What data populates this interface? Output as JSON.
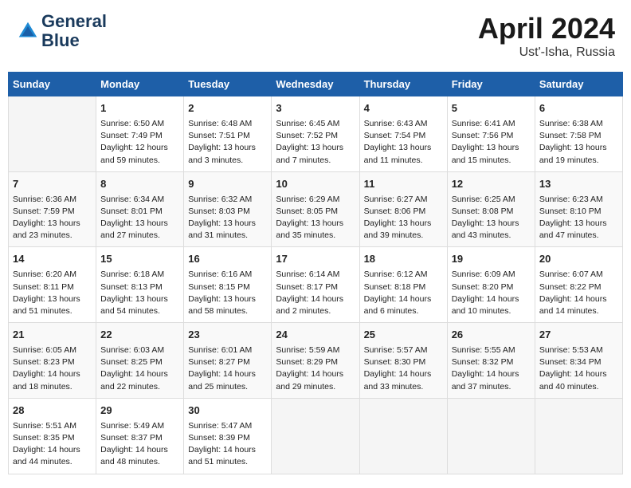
{
  "header": {
    "logo_line1": "General",
    "logo_line2": "Blue",
    "title": "April 2024",
    "subtitle": "Ust'-Isha, Russia"
  },
  "days_of_week": [
    "Sunday",
    "Monday",
    "Tuesday",
    "Wednesday",
    "Thursday",
    "Friday",
    "Saturday"
  ],
  "weeks": [
    [
      {
        "day": "",
        "content": ""
      },
      {
        "day": "1",
        "content": "Sunrise: 6:50 AM\nSunset: 7:49 PM\nDaylight: 12 hours\nand 59 minutes."
      },
      {
        "day": "2",
        "content": "Sunrise: 6:48 AM\nSunset: 7:51 PM\nDaylight: 13 hours\nand 3 minutes."
      },
      {
        "day": "3",
        "content": "Sunrise: 6:45 AM\nSunset: 7:52 PM\nDaylight: 13 hours\nand 7 minutes."
      },
      {
        "day": "4",
        "content": "Sunrise: 6:43 AM\nSunset: 7:54 PM\nDaylight: 13 hours\nand 11 minutes."
      },
      {
        "day": "5",
        "content": "Sunrise: 6:41 AM\nSunset: 7:56 PM\nDaylight: 13 hours\nand 15 minutes."
      },
      {
        "day": "6",
        "content": "Sunrise: 6:38 AM\nSunset: 7:58 PM\nDaylight: 13 hours\nand 19 minutes."
      }
    ],
    [
      {
        "day": "7",
        "content": "Sunrise: 6:36 AM\nSunset: 7:59 PM\nDaylight: 13 hours\nand 23 minutes."
      },
      {
        "day": "8",
        "content": "Sunrise: 6:34 AM\nSunset: 8:01 PM\nDaylight: 13 hours\nand 27 minutes."
      },
      {
        "day": "9",
        "content": "Sunrise: 6:32 AM\nSunset: 8:03 PM\nDaylight: 13 hours\nand 31 minutes."
      },
      {
        "day": "10",
        "content": "Sunrise: 6:29 AM\nSunset: 8:05 PM\nDaylight: 13 hours\nand 35 minutes."
      },
      {
        "day": "11",
        "content": "Sunrise: 6:27 AM\nSunset: 8:06 PM\nDaylight: 13 hours\nand 39 minutes."
      },
      {
        "day": "12",
        "content": "Sunrise: 6:25 AM\nSunset: 8:08 PM\nDaylight: 13 hours\nand 43 minutes."
      },
      {
        "day": "13",
        "content": "Sunrise: 6:23 AM\nSunset: 8:10 PM\nDaylight: 13 hours\nand 47 minutes."
      }
    ],
    [
      {
        "day": "14",
        "content": "Sunrise: 6:20 AM\nSunset: 8:11 PM\nDaylight: 13 hours\nand 51 minutes."
      },
      {
        "day": "15",
        "content": "Sunrise: 6:18 AM\nSunset: 8:13 PM\nDaylight: 13 hours\nand 54 minutes."
      },
      {
        "day": "16",
        "content": "Sunrise: 6:16 AM\nSunset: 8:15 PM\nDaylight: 13 hours\nand 58 minutes."
      },
      {
        "day": "17",
        "content": "Sunrise: 6:14 AM\nSunset: 8:17 PM\nDaylight: 14 hours\nand 2 minutes."
      },
      {
        "day": "18",
        "content": "Sunrise: 6:12 AM\nSunset: 8:18 PM\nDaylight: 14 hours\nand 6 minutes."
      },
      {
        "day": "19",
        "content": "Sunrise: 6:09 AM\nSunset: 8:20 PM\nDaylight: 14 hours\nand 10 minutes."
      },
      {
        "day": "20",
        "content": "Sunrise: 6:07 AM\nSunset: 8:22 PM\nDaylight: 14 hours\nand 14 minutes."
      }
    ],
    [
      {
        "day": "21",
        "content": "Sunrise: 6:05 AM\nSunset: 8:23 PM\nDaylight: 14 hours\nand 18 minutes."
      },
      {
        "day": "22",
        "content": "Sunrise: 6:03 AM\nSunset: 8:25 PM\nDaylight: 14 hours\nand 22 minutes."
      },
      {
        "day": "23",
        "content": "Sunrise: 6:01 AM\nSunset: 8:27 PM\nDaylight: 14 hours\nand 25 minutes."
      },
      {
        "day": "24",
        "content": "Sunrise: 5:59 AM\nSunset: 8:29 PM\nDaylight: 14 hours\nand 29 minutes."
      },
      {
        "day": "25",
        "content": "Sunrise: 5:57 AM\nSunset: 8:30 PM\nDaylight: 14 hours\nand 33 minutes."
      },
      {
        "day": "26",
        "content": "Sunrise: 5:55 AM\nSunset: 8:32 PM\nDaylight: 14 hours\nand 37 minutes."
      },
      {
        "day": "27",
        "content": "Sunrise: 5:53 AM\nSunset: 8:34 PM\nDaylight: 14 hours\nand 40 minutes."
      }
    ],
    [
      {
        "day": "28",
        "content": "Sunrise: 5:51 AM\nSunset: 8:35 PM\nDaylight: 14 hours\nand 44 minutes."
      },
      {
        "day": "29",
        "content": "Sunrise: 5:49 AM\nSunset: 8:37 PM\nDaylight: 14 hours\nand 48 minutes."
      },
      {
        "day": "30",
        "content": "Sunrise: 5:47 AM\nSunset: 8:39 PM\nDaylight: 14 hours\nand 51 minutes."
      },
      {
        "day": "",
        "content": ""
      },
      {
        "day": "",
        "content": ""
      },
      {
        "day": "",
        "content": ""
      },
      {
        "day": "",
        "content": ""
      }
    ]
  ]
}
